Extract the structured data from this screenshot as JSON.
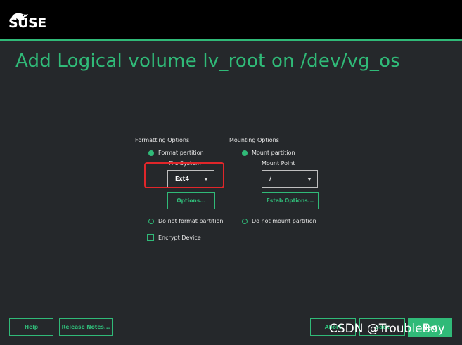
{
  "brand": {
    "name": "SUSE"
  },
  "page": {
    "title": "Add Logical volume lv_root on /dev/vg_os"
  },
  "formatting": {
    "heading": "Formatting Options",
    "format_partition": "Format partition",
    "file_system_label": "File System",
    "file_system_value": "Ext4",
    "options_button": "Options...",
    "do_not_format": "Do not format partition",
    "encrypt_device": "Encrypt Device"
  },
  "mounting": {
    "heading": "Mounting Options",
    "mount_partition": "Mount partition",
    "mount_point_label": "Mount Point",
    "mount_point_value": "/",
    "fstab_button": "Fstab Options...",
    "do_not_mount": "Do not mount partition"
  },
  "footer": {
    "help": "Help",
    "release_notes": "Release Notes...",
    "abort": "Abort",
    "back": "Back",
    "next": "Next"
  },
  "watermark": "CSDN @TroubleBoy",
  "colors": {
    "accent": "#30ba78",
    "background": "#25282b",
    "highlight": "#e0262a"
  }
}
